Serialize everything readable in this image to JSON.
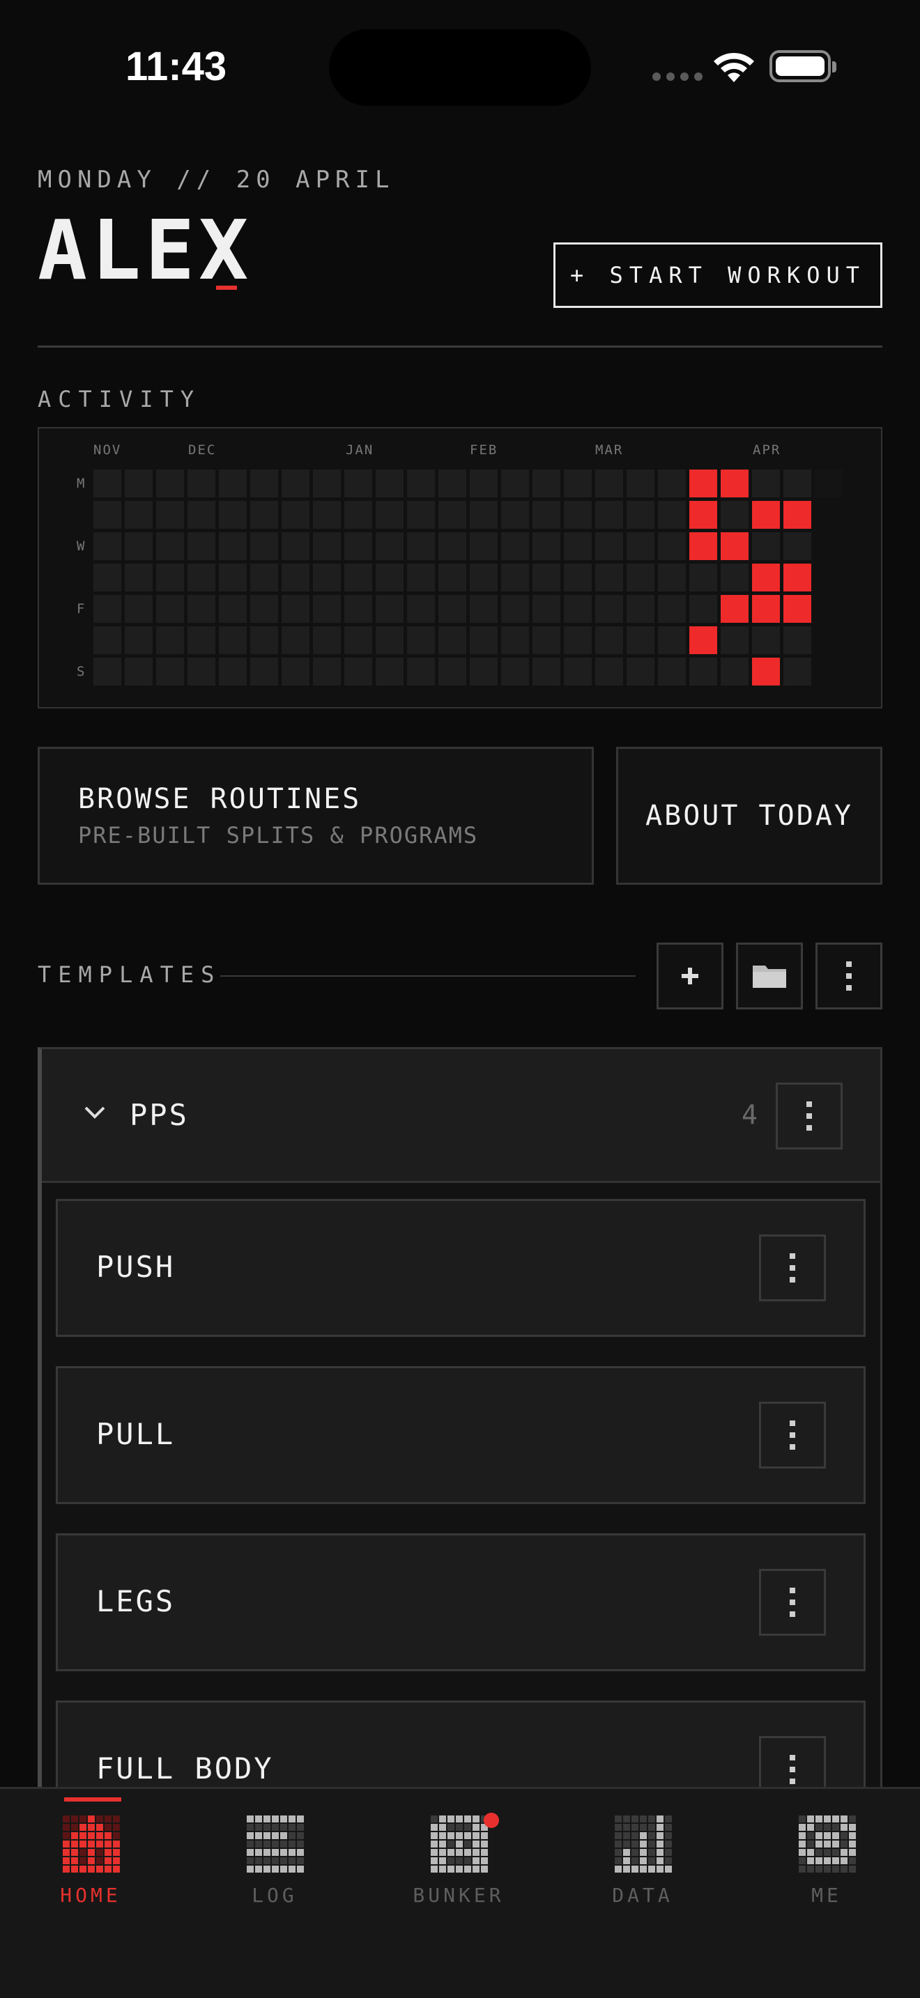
{
  "status_bar": {
    "time": "11:43"
  },
  "header": {
    "date": "MONDAY // 20 APRIL",
    "user_name": "ALEX",
    "cursor": "_",
    "start_workout_label": "+ START WORKOUT"
  },
  "activity": {
    "label": "ACTIVITY",
    "months": [
      "NOV",
      "DEC",
      "JAN",
      "FEB",
      "MAR",
      "APR"
    ],
    "day_labels": [
      "M",
      "W",
      "F",
      "S"
    ],
    "accent_color": "#ef2a2a",
    "active_cells": [
      {
        "week": 19,
        "day": 0
      },
      {
        "week": 20,
        "day": 0
      },
      {
        "week": 19,
        "day": 1
      },
      {
        "week": 21,
        "day": 1
      },
      {
        "week": 22,
        "day": 1
      },
      {
        "week": 19,
        "day": 2
      },
      {
        "week": 20,
        "day": 2
      },
      {
        "week": 21,
        "day": 3
      },
      {
        "week": 22,
        "day": 3
      },
      {
        "week": 20,
        "day": 4
      },
      {
        "week": 21,
        "day": 4
      },
      {
        "week": 22,
        "day": 4
      },
      {
        "week": 19,
        "day": 5
      },
      {
        "week": 21,
        "day": 6
      }
    ]
  },
  "cards": {
    "browse_title": "BROWSE ROUTINES",
    "browse_sub": "PRE-BUILT SPLITS & PROGRAMS",
    "about_title": "ABOUT TODAY"
  },
  "templates": {
    "label": "TEMPLATES",
    "add_icon": "plus-icon",
    "folder_icon": "folder-icon",
    "more_icon": "kebab-icon",
    "group": {
      "name": "PPS",
      "count": "4",
      "items": [
        {
          "name": "PUSH"
        },
        {
          "name": "PULL"
        },
        {
          "name": "LEGS"
        },
        {
          "name": "FULL BODY"
        }
      ]
    }
  },
  "tabs": [
    {
      "label": "HOME",
      "icon": "home-icon",
      "active": true
    },
    {
      "label": "LOG",
      "icon": "log-icon",
      "active": false
    },
    {
      "label": "BUNKER",
      "icon": "bunker-icon",
      "active": false,
      "badge": true
    },
    {
      "label": "DATA",
      "icon": "data-icon",
      "active": false
    },
    {
      "label": "ME",
      "icon": "me-icon",
      "active": false
    }
  ]
}
